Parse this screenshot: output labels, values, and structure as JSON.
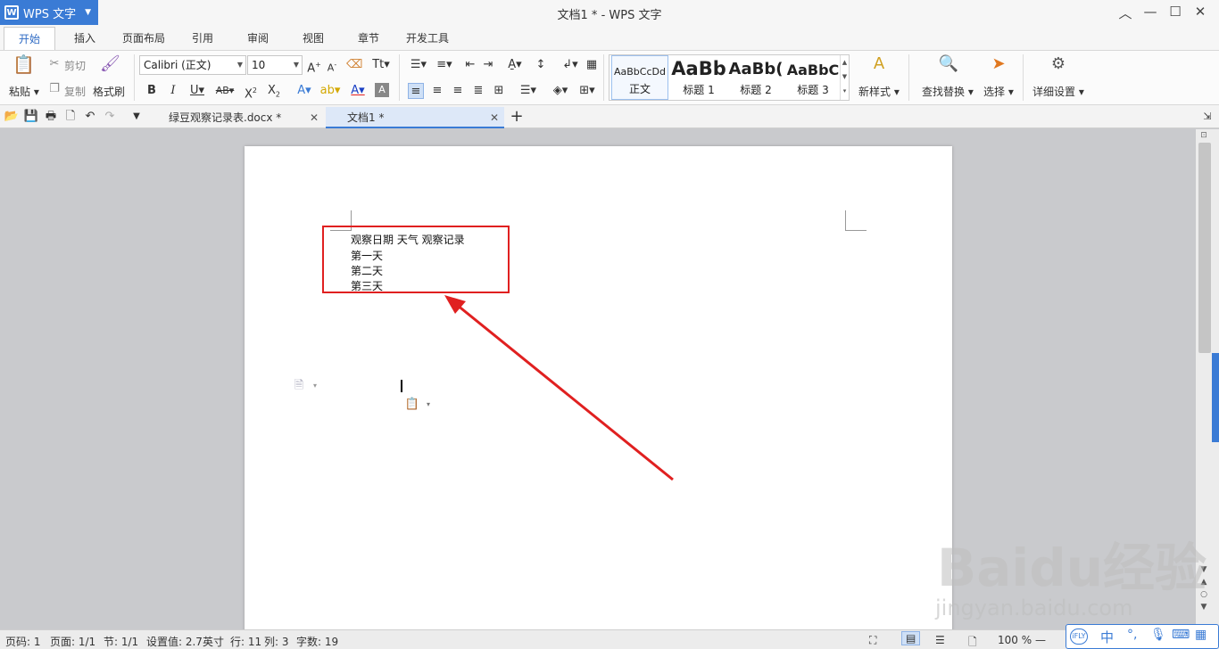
{
  "app": {
    "name": "WPS 文字",
    "window_title": "文档1 * - WPS 文字"
  },
  "ribbon_tabs": [
    "开始",
    "插入",
    "页面布局",
    "引用",
    "审阅",
    "视图",
    "章节",
    "开发工具"
  ],
  "toolbar": {
    "paste": "粘贴",
    "cut": "剪切",
    "copy": "复制",
    "format_painter": "格式刷",
    "font_name": "Calibri (正文)",
    "font_size": "10",
    "new_style": "新样式",
    "find_replace": "查找替换",
    "select": "选择",
    "detail_settings": "详细设置"
  },
  "styles": [
    {
      "preview": "AaBbCcDd",
      "label": "正文"
    },
    {
      "preview": "AaBb",
      "label": "标题 1"
    },
    {
      "preview": "AaBb(",
      "label": "标题 2"
    },
    {
      "preview": "AaBbC",
      "label": "标题 3"
    }
  ],
  "doc_tabs": [
    {
      "label": "绿豆观察记录表.docx *",
      "active": false
    },
    {
      "label": "文档1 *",
      "active": true
    }
  ],
  "document": {
    "lines": [
      "观察日期 天气 观察记录",
      "第一天",
      "第二天",
      "第三天"
    ]
  },
  "status": {
    "page_code": "页码: 1",
    "page": "页面: 1/1",
    "section": "节: 1/1",
    "setting": "设置值: 2.7英寸",
    "row": "行: 11",
    "col": "列: 3",
    "word_count": "字数: 19",
    "zoom": "100 %"
  },
  "ime": {
    "label": "中"
  },
  "watermark": {
    "brand": "Baidu经验",
    "url": "jingyan.baidu.com"
  },
  "colors": {
    "accent": "#3a7bd5",
    "highlight_box": "#e02020",
    "arrow": "#e02020"
  }
}
